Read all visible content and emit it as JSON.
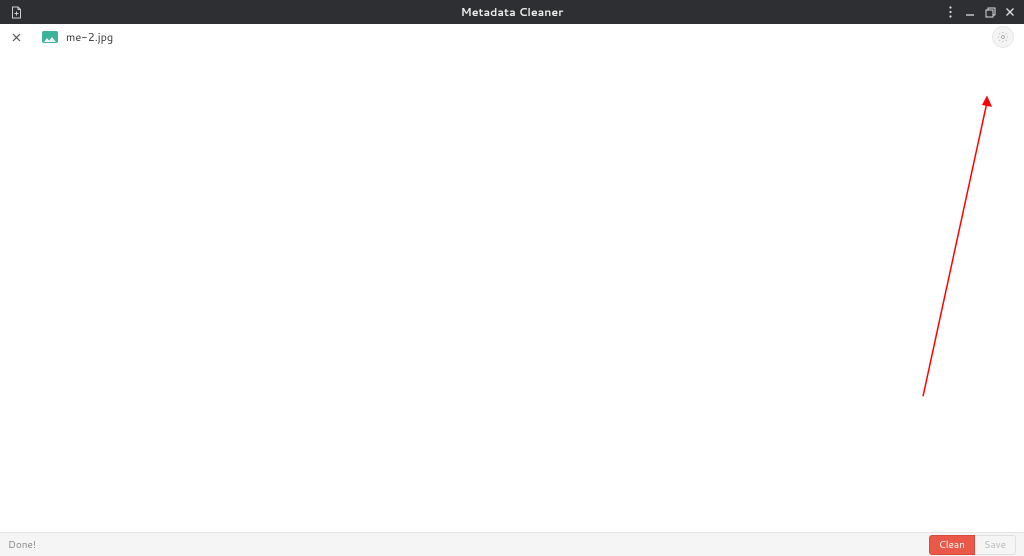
{
  "titlebar": {
    "title": "Metadata Cleaner"
  },
  "file": {
    "name": "me-2.jpg"
  },
  "status": {
    "text": "Done!"
  },
  "actions": {
    "clean": "Clean",
    "save": "Save"
  }
}
